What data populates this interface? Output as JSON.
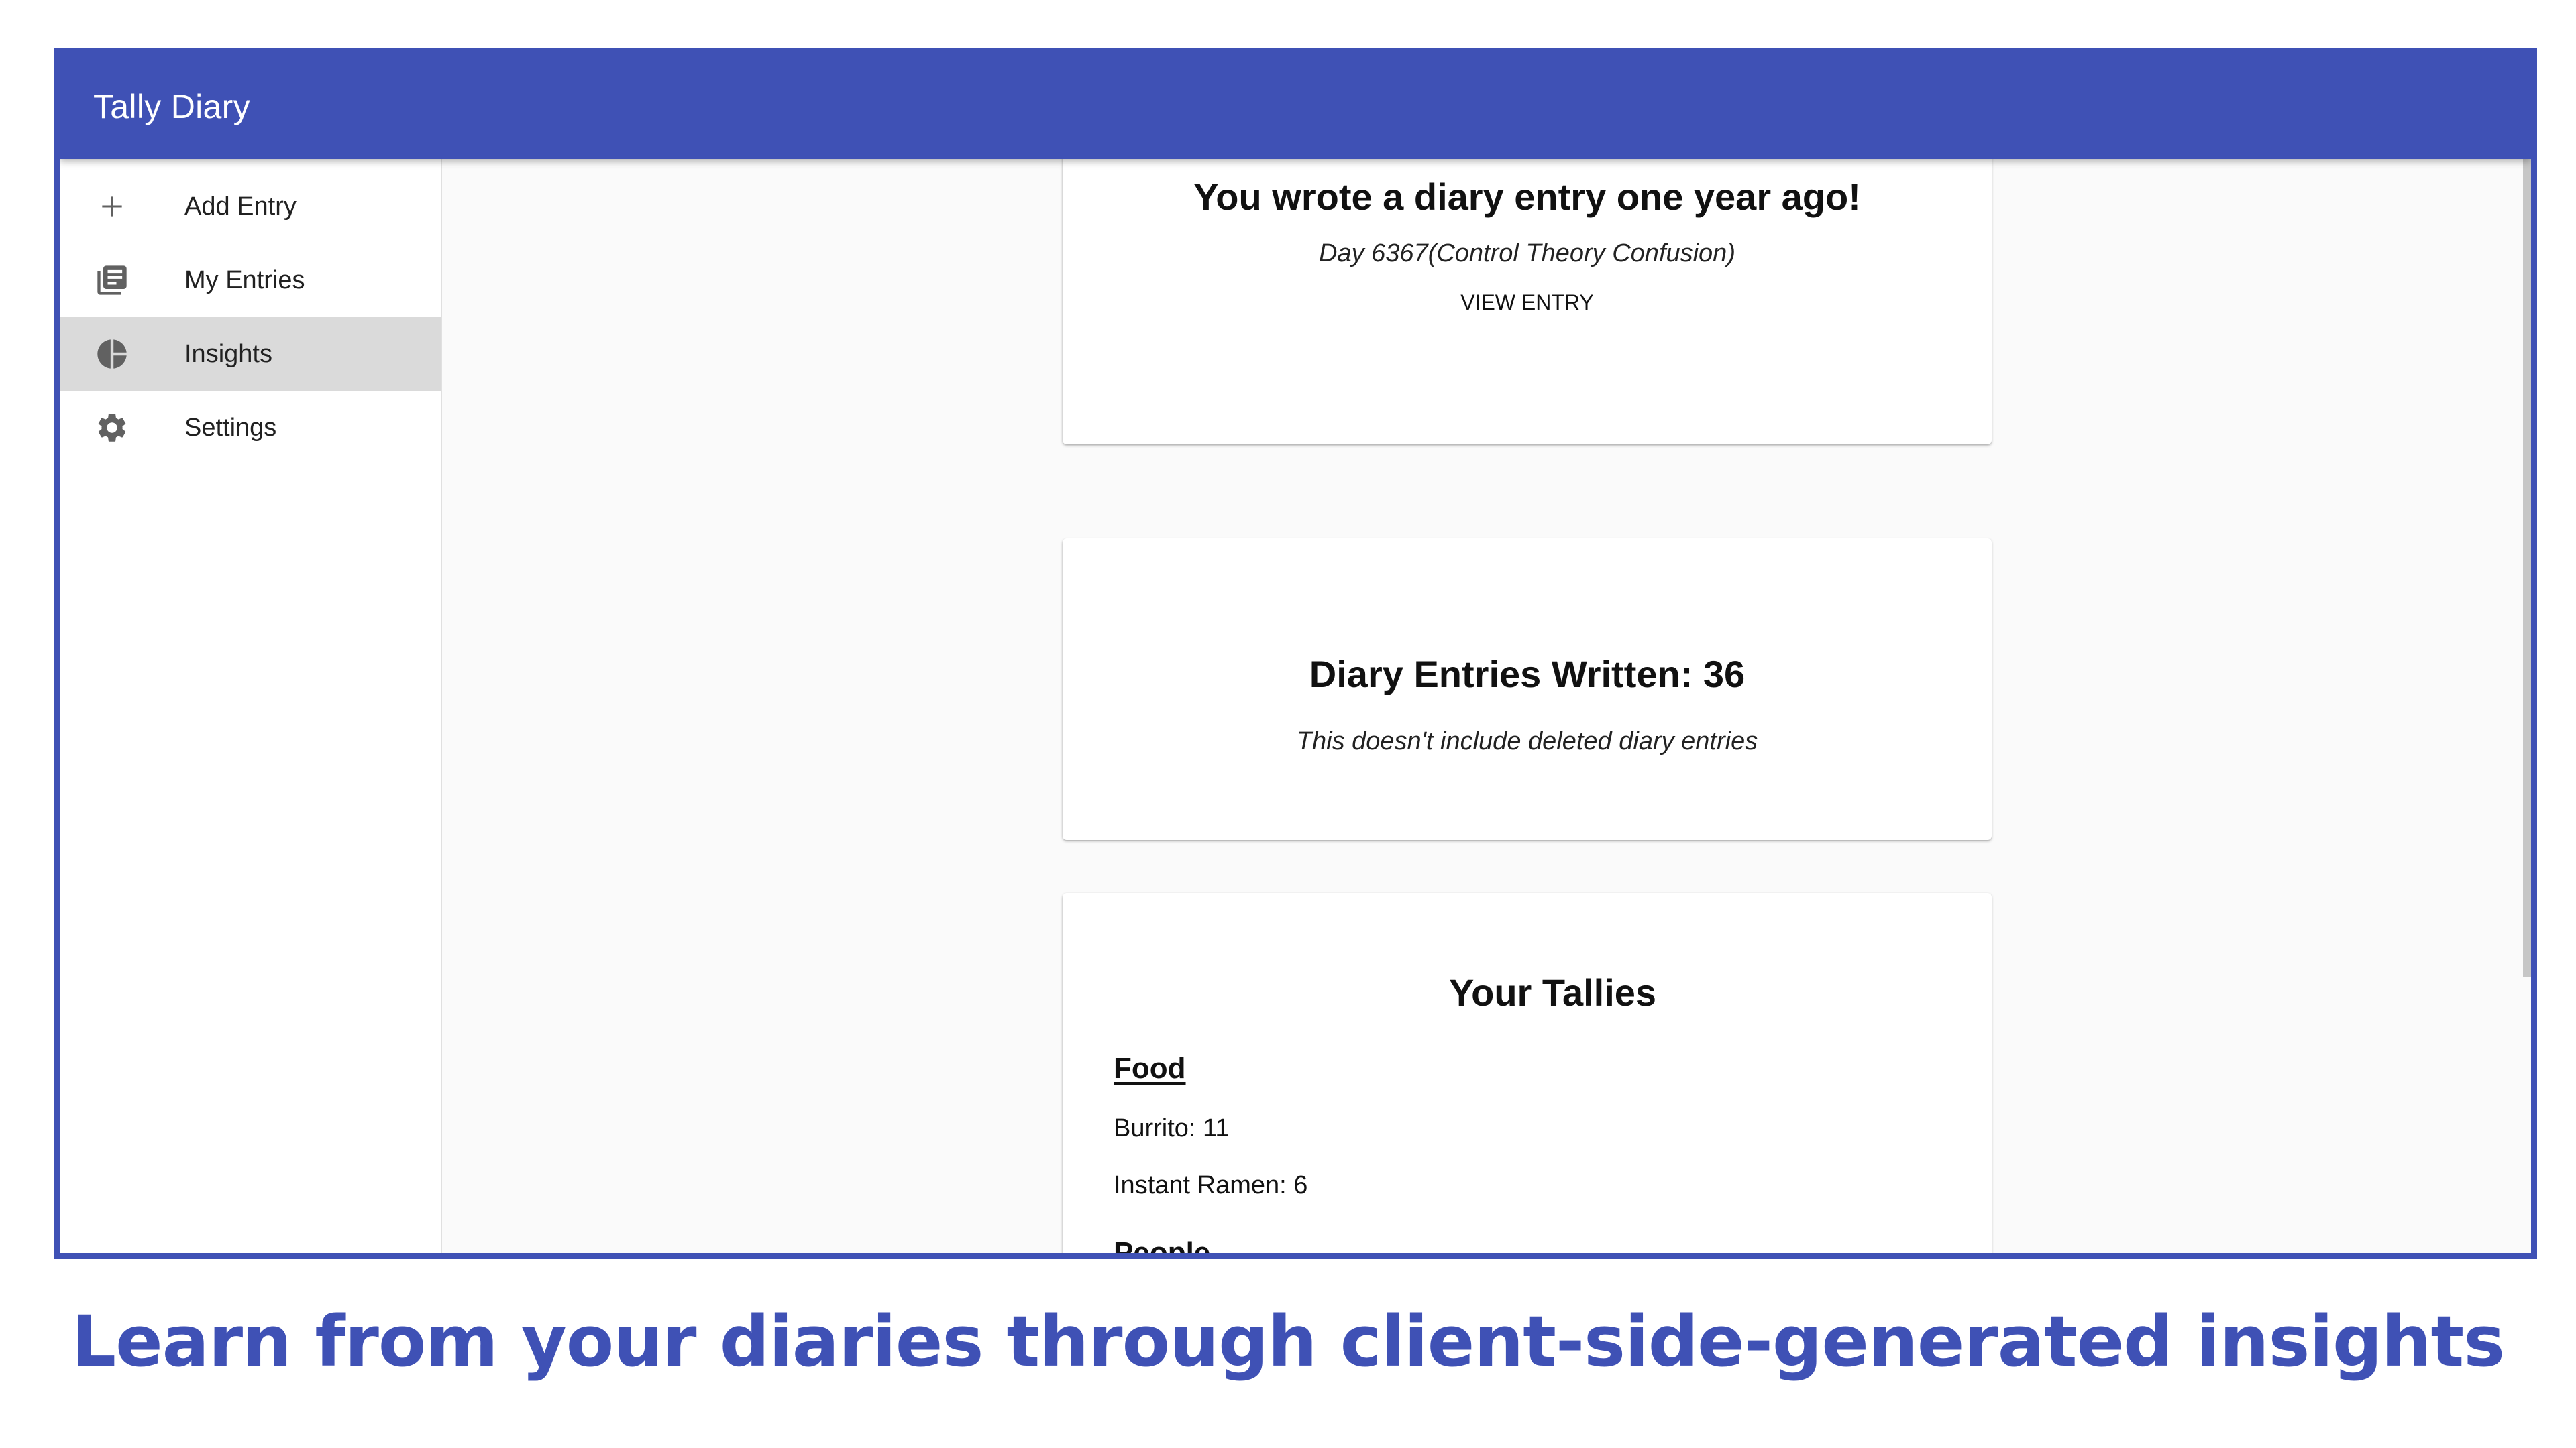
{
  "app": {
    "title": "Tally Diary"
  },
  "sidebar": {
    "items": [
      {
        "label": "Add Entry",
        "icon": "plus-icon",
        "active": false
      },
      {
        "label": "My Entries",
        "icon": "library-books-icon",
        "active": false
      },
      {
        "label": "Insights",
        "icon": "pie-chart-icon",
        "active": true
      },
      {
        "label": "Settings",
        "icon": "gear-icon",
        "active": false
      }
    ]
  },
  "cards": {
    "memory": {
      "title": "You wrote a diary entry one year ago!",
      "entry_title": "Day 6367(Control Theory Confusion)",
      "button_label": "VIEW ENTRY"
    },
    "count": {
      "title": "Diary Entries Written: 36",
      "note": "This doesn't include deleted diary entries"
    },
    "tallies": {
      "title": "Your Tallies",
      "categories": [
        {
          "name": "Food",
          "items": [
            {
              "text": "Burrito: 11"
            },
            {
              "text": "Instant Ramen: 6"
            }
          ]
        },
        {
          "name": "People",
          "items": []
        }
      ]
    }
  },
  "caption": "Learn from your diaries through client-side-generated insights",
  "colors": {
    "primary": "#3f51b5",
    "active_nav": "#dadada",
    "background": "#fafafa",
    "icon": "#616161"
  }
}
